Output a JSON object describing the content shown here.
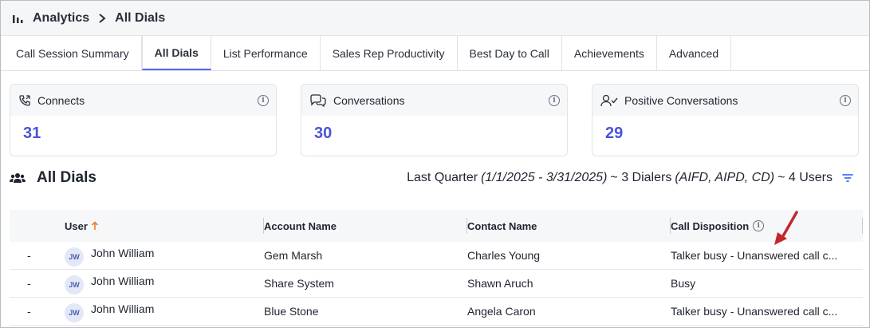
{
  "breadcrumb": {
    "section": "Analytics",
    "page": "All Dials"
  },
  "tabs": [
    {
      "label": "Call Session Summary",
      "active": false
    },
    {
      "label": "All Dials",
      "active": true
    },
    {
      "label": "List Performance",
      "active": false
    },
    {
      "label": "Sales Rep Productivity",
      "active": false
    },
    {
      "label": "Best Day to Call",
      "active": false
    },
    {
      "label": "Achievements",
      "active": false
    },
    {
      "label": "Advanced",
      "active": false
    }
  ],
  "cards": [
    {
      "title": "Connects",
      "value": "31",
      "icon": "phone-connect-icon"
    },
    {
      "title": "Conversations",
      "value": "30",
      "icon": "chat-bubbles-icon"
    },
    {
      "title": "Positive Conversations",
      "value": "29",
      "icon": "user-check-icon"
    }
  ],
  "section": {
    "title": "All Dials",
    "period": "Last Quarter",
    "range": "(1/1/2025 - 3/31/2025)",
    "dialers_prefix": "~ 3 Dialers",
    "dialers": "(AIFD, AIPD, CD)",
    "users": "~ 4 Users"
  },
  "table": {
    "headers": {
      "user": "User",
      "account": "Account Name",
      "contact": "Contact Name",
      "disposition": "Call Disposition"
    },
    "rows": [
      {
        "dash": "-",
        "initials": "JW",
        "user": "John William",
        "account": "Gem Marsh",
        "contact": "Charles Young",
        "disposition": "Talker busy - Unanswered call c..."
      },
      {
        "dash": "-",
        "initials": "JW",
        "user": "John William",
        "account": "Share System",
        "contact": "Shawn Aruch",
        "disposition": "Busy"
      },
      {
        "dash": "-",
        "initials": "JW",
        "user": "John William",
        "account": "Blue Stone",
        "contact": "Angela Caron",
        "disposition": "Talker busy - Unanswered call c..."
      }
    ]
  },
  "colors": {
    "accent": "#4a6cf7",
    "value": "#4b53d9",
    "sort_arrow": "#f07b2c",
    "annotation": "#c2272d"
  }
}
